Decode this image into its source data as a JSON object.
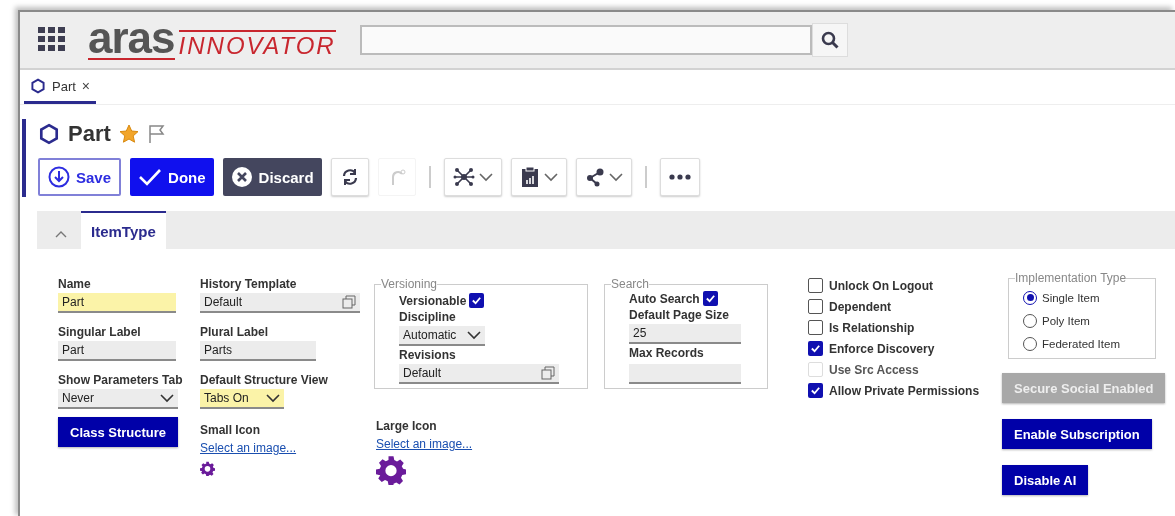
{
  "header": {
    "logo": {
      "primary": "aras",
      "secondary": "INNOVATOR"
    }
  },
  "tabs": [
    {
      "label": "Part",
      "close": "×",
      "selected": true
    }
  ],
  "item": {
    "title": "Part",
    "favorite": true,
    "flagged": false
  },
  "actions": [
    {
      "label": "Save",
      "kind": "outline"
    },
    {
      "label": "Done",
      "kind": "primary"
    },
    {
      "label": "Discard",
      "kind": "dark"
    }
  ],
  "tool_groups": [
    {
      "tools": [
        {
          "kind": "refresh",
          "disabled": false,
          "menu": false
        },
        {
          "kind": "redo",
          "disabled": true,
          "menu": false
        }
      ]
    },
    {
      "tools": [
        {
          "kind": "network",
          "disabled": false,
          "menu": true
        },
        {
          "kind": "clipboard",
          "disabled": false,
          "menu": true
        },
        {
          "kind": "share",
          "disabled": false,
          "menu": true
        }
      ]
    },
    {
      "tools": [
        {
          "kind": "more",
          "disabled": false,
          "menu": false
        }
      ]
    }
  ],
  "section": {
    "title": "ItemType",
    "expanded": true
  },
  "form": {
    "column_1": [
      {
        "kind": "text",
        "label": "Name",
        "value": "Part",
        "required": true
      },
      {
        "kind": "text",
        "label": "Singular Label",
        "value": "Part",
        "required": false
      },
      {
        "kind": "select",
        "label": "Show Parameters Tab",
        "value": "Never",
        "required": false
      }
    ],
    "class_structure_button": "Class Structure",
    "column_2": [
      {
        "kind": "lookup",
        "label": "History Template",
        "value": "Default",
        "required": false
      },
      {
        "kind": "text",
        "label": "Plural Label",
        "value": "Parts",
        "required": false
      },
      {
        "kind": "select",
        "label": "Default Structure View",
        "value": "Tabs On",
        "required": true
      }
    ],
    "small_icon": {
      "label": "Small Icon",
      "link": "Select an image..."
    },
    "versioning": {
      "legend": "Versioning",
      "versionable": {
        "label": "Versionable",
        "checked": true
      },
      "discipline": {
        "label": "Discipline",
        "value": "Automatic"
      },
      "revisions": {
        "label": "Revisions",
        "value": "Default"
      }
    },
    "large_icon": {
      "label": "Large Icon",
      "link": "Select an image..."
    },
    "search": {
      "legend": "Search",
      "auto_search": {
        "label": "Auto Search",
        "checked": true
      },
      "page_size": {
        "label": "Default Page Size",
        "value": "25"
      },
      "max_records": {
        "label": "Max Records"
      }
    },
    "options": [
      {
        "label": "Unlock On Logout",
        "checked": false,
        "disabled": false
      },
      {
        "label": "Dependent",
        "checked": false,
        "disabled": false
      },
      {
        "label": "Is Relationship",
        "checked": false,
        "disabled": false
      },
      {
        "label": "Enforce Discovery",
        "checked": true,
        "disabled": false
      },
      {
        "label": "Use Src Access",
        "checked": false,
        "disabled": true
      },
      {
        "label": "Allow Private Permissions",
        "checked": true,
        "disabled": false
      }
    ],
    "implementation_type": {
      "legend": "Implementation Type",
      "options": [
        {
          "label": "Single Item",
          "selected": true
        },
        {
          "label": "Poly Item",
          "selected": false
        },
        {
          "label": "Federated Item",
          "selected": false
        }
      ]
    },
    "side_buttons": [
      {
        "label": "Secure Social Enabled",
        "disabled": true
      },
      {
        "label": "Enable Subscription",
        "disabled": false
      },
      {
        "label": "Disable AI",
        "disabled": false
      }
    ]
  }
}
